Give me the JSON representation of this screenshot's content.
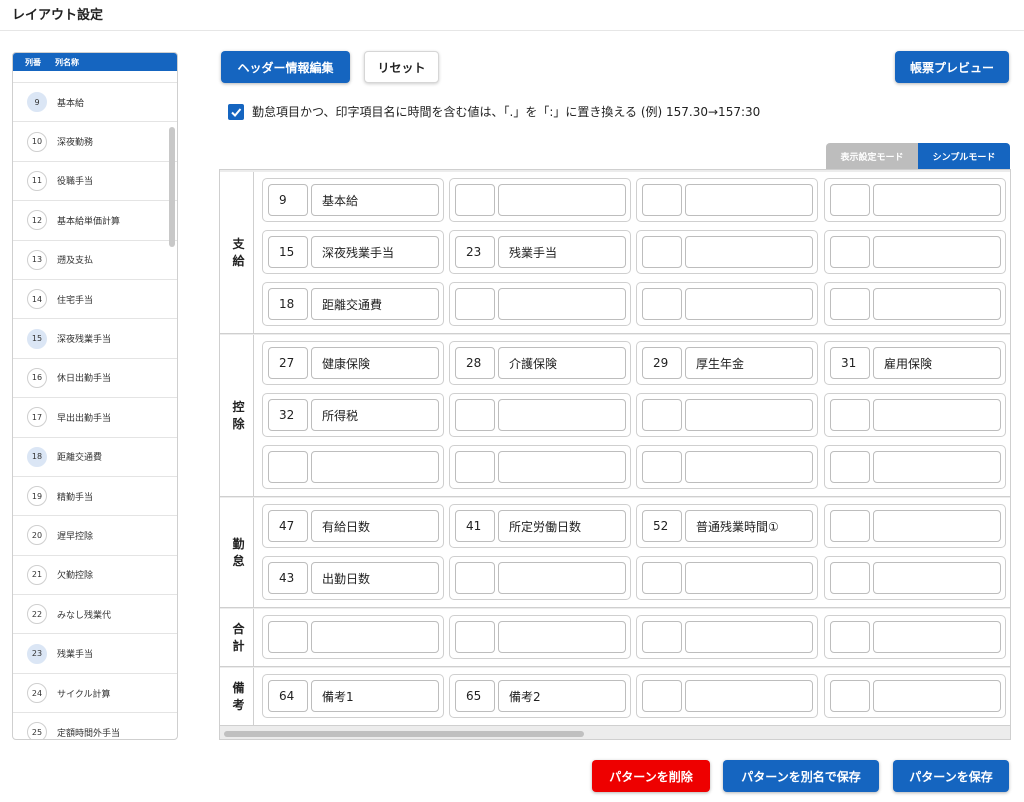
{
  "page_title": "レイアウト設定",
  "column_list": {
    "header_number": "列番",
    "header_name": "列名称",
    "items": [
      {
        "no": "9",
        "name": "基本給",
        "used": true
      },
      {
        "no": "10",
        "name": "深夜勤務",
        "used": false
      },
      {
        "no": "11",
        "name": "役職手当",
        "used": false
      },
      {
        "no": "12",
        "name": "基本給単価計算",
        "used": false
      },
      {
        "no": "13",
        "name": "遡及支払",
        "used": false
      },
      {
        "no": "14",
        "name": "住宅手当",
        "used": false
      },
      {
        "no": "15",
        "name": "深夜残業手当",
        "used": true
      },
      {
        "no": "16",
        "name": "休日出勤手当",
        "used": false
      },
      {
        "no": "17",
        "name": "早出出勤手当",
        "used": false
      },
      {
        "no": "18",
        "name": "距離交通費",
        "used": true
      },
      {
        "no": "19",
        "name": "精勤手当",
        "used": false
      },
      {
        "no": "20",
        "name": "遅早控除",
        "used": false
      },
      {
        "no": "21",
        "name": "欠勤控除",
        "used": false
      },
      {
        "no": "22",
        "name": "みなし残業代",
        "used": false
      },
      {
        "no": "23",
        "name": "残業手当",
        "used": true
      },
      {
        "no": "24",
        "name": "サイクル計算",
        "used": false
      },
      {
        "no": "25",
        "name": "定額時間外手当",
        "used": false
      }
    ]
  },
  "toolbar": {
    "header_edit": "ヘッダー情報編集",
    "reset": "リセット",
    "preview": "帳票プレビュー"
  },
  "checkbox": {
    "checked": true,
    "label": "勤怠項目かつ、印字項目名に時間を含む値は、「.」を「:」に置き換える (例) 157.30→157:30"
  },
  "mode_tabs": {
    "display_mode": "表示設定モード",
    "simple_mode": "シンプルモード"
  },
  "sections": [
    {
      "label": [
        "支",
        "給"
      ],
      "rows": [
        [
          {
            "code": "9",
            "name": "基本給"
          },
          {
            "code": "",
            "name": ""
          },
          {
            "code": "",
            "name": ""
          },
          {
            "code": "",
            "name": ""
          }
        ],
        [
          {
            "code": "15",
            "name": "深夜残業手当"
          },
          {
            "code": "23",
            "name": "残業手当"
          },
          {
            "code": "",
            "name": ""
          },
          {
            "code": "",
            "name": ""
          }
        ],
        [
          {
            "code": "18",
            "name": "距離交通費"
          },
          {
            "code": "",
            "name": ""
          },
          {
            "code": "",
            "name": ""
          },
          {
            "code": "",
            "name": ""
          }
        ]
      ]
    },
    {
      "label": [
        "控",
        "除"
      ],
      "rows": [
        [
          {
            "code": "27",
            "name": "健康保険"
          },
          {
            "code": "28",
            "name": "介護保険"
          },
          {
            "code": "29",
            "name": "厚生年金"
          },
          {
            "code": "31",
            "name": "雇用保険"
          }
        ],
        [
          {
            "code": "32",
            "name": "所得税"
          },
          {
            "code": "",
            "name": ""
          },
          {
            "code": "",
            "name": ""
          },
          {
            "code": "",
            "name": ""
          }
        ],
        [
          {
            "code": "",
            "name": ""
          },
          {
            "code": "",
            "name": ""
          },
          {
            "code": "",
            "name": ""
          },
          {
            "code": "",
            "name": ""
          }
        ]
      ]
    },
    {
      "label": [
        "勤",
        "怠"
      ],
      "rows": [
        [
          {
            "code": "47",
            "name": "有給日数"
          },
          {
            "code": "41",
            "name": "所定労働日数"
          },
          {
            "code": "52",
            "name": "普通残業時間①"
          },
          {
            "code": "",
            "name": ""
          }
        ],
        [
          {
            "code": "43",
            "name": "出勤日数"
          },
          {
            "code": "",
            "name": ""
          },
          {
            "code": "",
            "name": ""
          },
          {
            "code": "",
            "name": ""
          }
        ]
      ]
    },
    {
      "label": [
        "合",
        "計"
      ],
      "rows": [
        [
          {
            "code": "",
            "name": ""
          },
          {
            "code": "",
            "name": ""
          },
          {
            "code": "",
            "name": ""
          },
          {
            "code": "",
            "name": ""
          }
        ]
      ]
    },
    {
      "label": [
        "備",
        "考"
      ],
      "rows": [
        [
          {
            "code": "64",
            "name": "備考1"
          },
          {
            "code": "65",
            "name": "備考2"
          },
          {
            "code": "",
            "name": ""
          },
          {
            "code": "",
            "name": ""
          }
        ]
      ]
    }
  ],
  "footer": {
    "delete": "パターンを削除",
    "save_as": "パターンを別名で保存",
    "save": "パターンを保存"
  },
  "colors": {
    "primary": "#1565c0",
    "danger": "#ee0000",
    "used_badge": "#dbe6f5"
  }
}
